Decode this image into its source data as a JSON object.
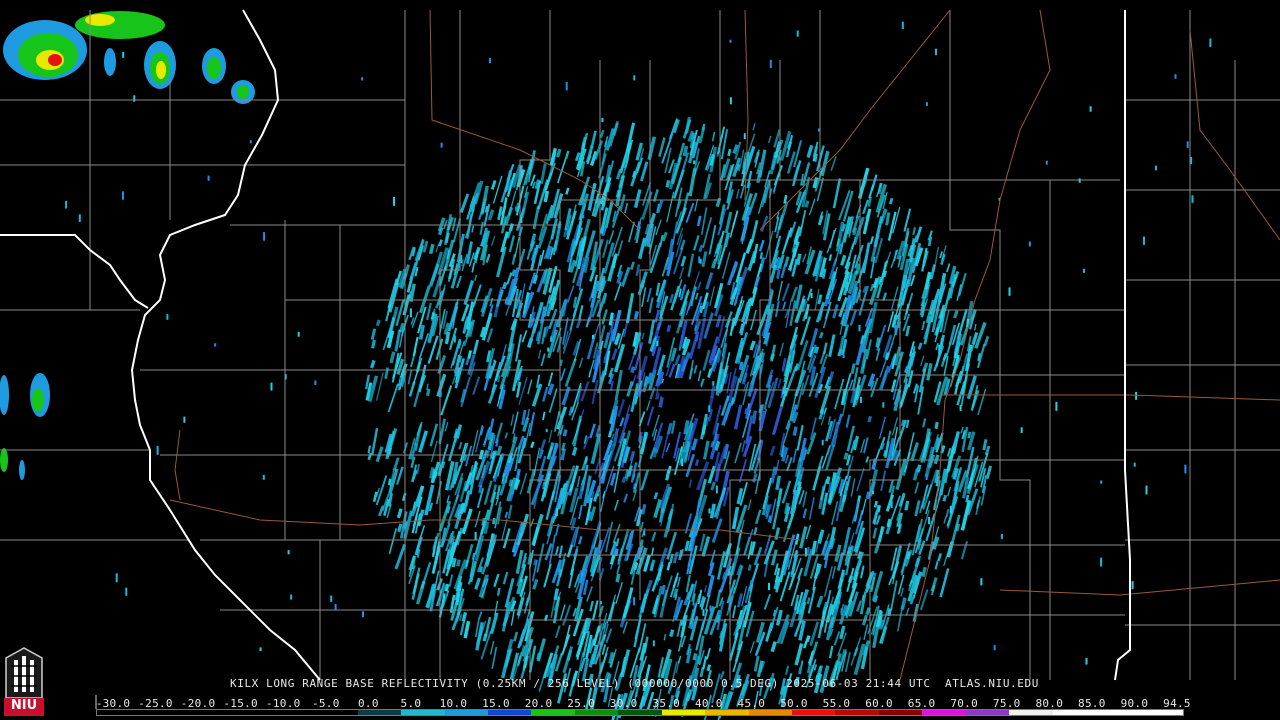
{
  "product": {
    "caption": "KILX LONG RANGE BASE REFLECTIVITY (0.25KM / 256 LEVEL) (000000/0000 0.5 DEG) 2025-06-03 21:44 UTC  ATLAS.NIU.EDU"
  },
  "legend": {
    "tick_labels": [
      "-30.0",
      "-25.0",
      "-20.0",
      "-15.0",
      "-10.0",
      "-5.0",
      "0.0",
      "5.0",
      "10.0",
      "15.0",
      "20.0",
      "25.0",
      "30.0",
      "35.0",
      "40.0",
      "45.0",
      "50.0",
      "55.0",
      "60.0",
      "65.0",
      "70.0",
      "75.0",
      "80.0",
      "85.0",
      "90.0",
      "94.5"
    ],
    "colors": [
      "#000000",
      "#000000",
      "#000000",
      "#000000",
      "#000000",
      "#000000",
      "#0d3b4a",
      "#22b8c8",
      "#1e9be0",
      "#1446d8",
      "#16c41a",
      "#0d8e12",
      "#05580a",
      "#e8e800",
      "#e8b800",
      "#e88800",
      "#e81010",
      "#b80808",
      "#8a0000",
      "#e010e0",
      "#8a3ac8",
      "#f0f0f0",
      "#ffffff",
      "#ffffff",
      "#ffffff"
    ],
    "unit_logo_text": "NIU"
  },
  "radar": {
    "site": "KILX",
    "echo_colors": [
      "#22d3e6",
      "#1ab8dc",
      "#1f8fe8",
      "#2a5ad8",
      "#55d0f0"
    ]
  }
}
